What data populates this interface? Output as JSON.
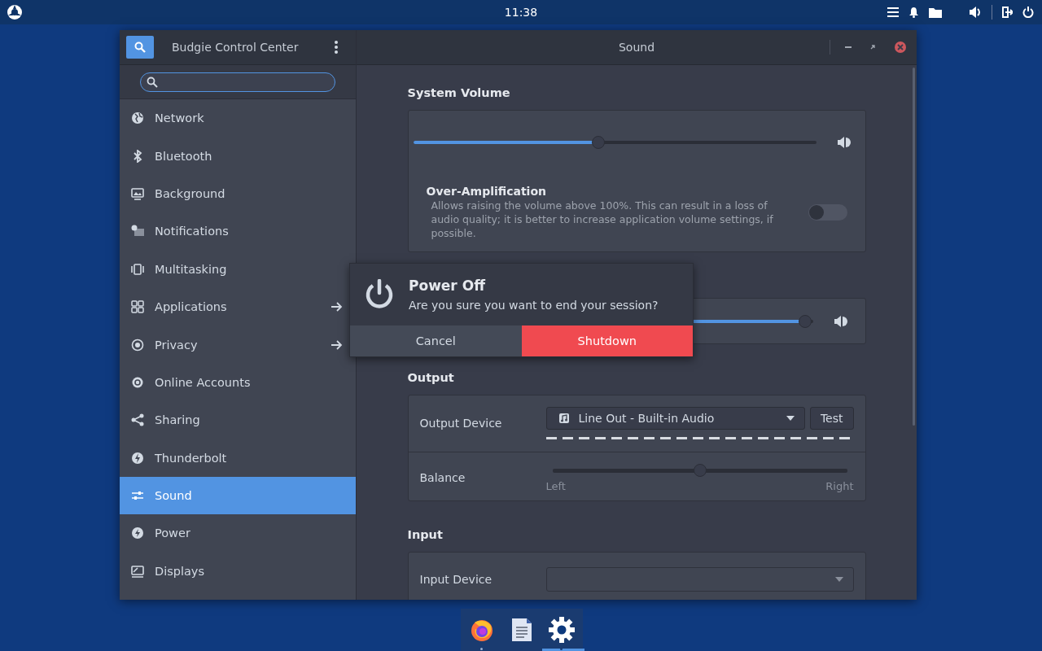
{
  "top_bar": {
    "clock": "11:38"
  },
  "window": {
    "app_title": "Budgie Control Center",
    "page_title": "Sound"
  },
  "sidebar": {
    "items": [
      {
        "label": "Network",
        "selected": false,
        "arrow": false
      },
      {
        "label": "Bluetooth",
        "selected": false,
        "arrow": false
      },
      {
        "label": "Background",
        "selected": false,
        "arrow": false
      },
      {
        "label": "Notifications",
        "selected": false,
        "arrow": false
      },
      {
        "label": "Multitasking",
        "selected": false,
        "arrow": false
      },
      {
        "label": "Applications",
        "selected": false,
        "arrow": true
      },
      {
        "label": "Privacy",
        "selected": false,
        "arrow": true
      },
      {
        "label": "Online Accounts",
        "selected": false,
        "arrow": false
      },
      {
        "label": "Sharing",
        "selected": false,
        "arrow": false
      },
      {
        "label": "Thunderbolt",
        "selected": false,
        "arrow": false
      },
      {
        "label": "Sound",
        "selected": true,
        "arrow": false
      },
      {
        "label": "Power",
        "selected": false,
        "arrow": false
      },
      {
        "label": "Displays",
        "selected": false,
        "arrow": false
      }
    ]
  },
  "system_volume": {
    "title": "System Volume",
    "level": 0.46,
    "over_amplification": {
      "title": "Over-Amplification",
      "description": "Allows raising the volume above 100%. This can result in a loss of audio quality; it is better to increase application volume settings, if possible.",
      "on": false
    }
  },
  "covered_card": {
    "level": 0.98
  },
  "output": {
    "title": "Output",
    "device_label": "Output Device",
    "device": "Line Out - Built-in Audio",
    "test_button": "Test",
    "balance_label": "Balance",
    "balance": {
      "level": 0.5,
      "left": "Left",
      "right": "Right"
    }
  },
  "input": {
    "title": "Input",
    "device_label": "Input Device"
  },
  "dialog": {
    "title": "Power Off",
    "message": "Are you sure you want to end your session?",
    "cancel": "Cancel",
    "confirm": "Shutdown"
  },
  "dock": {
    "items": [
      {
        "running": true,
        "selected": false
      },
      {
        "running": false,
        "selected": false
      },
      {
        "running": false,
        "selected": true
      }
    ]
  }
}
